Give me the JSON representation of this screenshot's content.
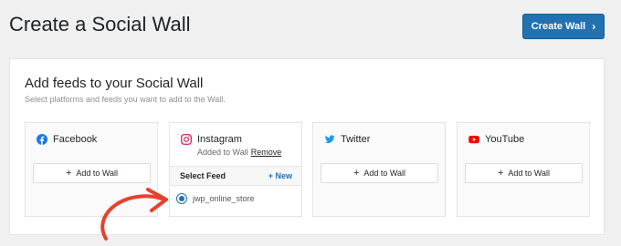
{
  "header": {
    "title": "Create a Social Wall",
    "create_button_label": "Create Wall",
    "create_button_icon": "chevron-right-icon"
  },
  "panel": {
    "title": "Add feeds to your Social Wall",
    "subtitle": "Select platforms and feeds you want to add to the Wall."
  },
  "platforms": {
    "facebook": {
      "name": "Facebook",
      "add_label": "Add to Wall",
      "color": "#1877f2"
    },
    "instagram": {
      "name": "Instagram",
      "status": "Added to Wall",
      "remove_label": "Remove",
      "select_feed_label": "Select Feed",
      "new_label": "+ New",
      "feed_name": "jwp_online_store",
      "feed_selected": true,
      "color": "#e1306c"
    },
    "twitter": {
      "name": "Twitter",
      "add_label": "Add to Wall",
      "color": "#1d9bf0"
    },
    "youtube": {
      "name": "YouTube",
      "add_label": "Add to Wall",
      "color": "#ff0000"
    }
  },
  "colors": {
    "accent": "#2271b1",
    "annotation_arrow": "#e8412c"
  }
}
